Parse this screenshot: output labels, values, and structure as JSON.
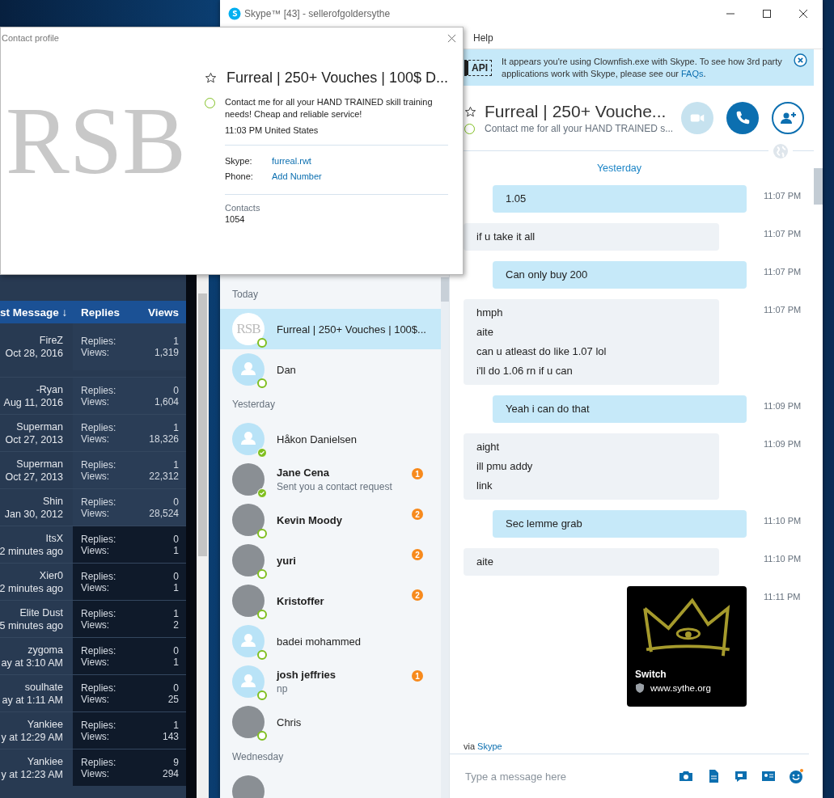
{
  "forum": {
    "columns": [
      "st Message ↓",
      "Replies",
      "Views"
    ],
    "rows": [
      {
        "poster": "FireZ",
        "date": "Oct 28, 2016",
        "replies_label": "Replies:",
        "replies": "1",
        "views_label": "Views:",
        "views": "1,319",
        "shaded": false
      },
      {
        "poster": "-Ryan",
        "date": "Aug 11, 2016",
        "replies_label": "Replies:",
        "replies": "0",
        "views_label": "Views:",
        "views": "1,604",
        "shaded": false
      },
      {
        "poster": "Superman",
        "date": "Oct 27, 2013",
        "replies_label": "Replies:",
        "replies": "1",
        "views_label": "Views:",
        "views": "18,326",
        "shaded": false
      },
      {
        "poster": "Superman",
        "date": "Oct 27, 2013",
        "replies_label": "Replies:",
        "replies": "1",
        "views_label": "Views:",
        "views": "22,312",
        "shaded": false
      },
      {
        "poster": "Shin",
        "date": "Jan 30, 2012",
        "replies_label": "Replies:",
        "replies": "0",
        "views_label": "Views:",
        "views": "28,524",
        "shaded": false
      },
      {
        "poster": "ItsX",
        "date": "2 minutes ago",
        "replies_label": "Replies:",
        "replies": "0",
        "views_label": "Views:",
        "views": "1",
        "shaded": true
      },
      {
        "poster": "Xier0",
        "date": "2 minutes ago",
        "replies_label": "Replies:",
        "replies": "0",
        "views_label": "Views:",
        "views": "1",
        "shaded": true
      },
      {
        "poster": "Elite Dust",
        "date": "5 minutes ago",
        "replies_label": "Replies:",
        "replies": "1",
        "views_label": "Views:",
        "views": "2",
        "shaded": true
      },
      {
        "poster": "zygoma",
        "date": "ay at 3:10 AM",
        "replies_label": "Replies:",
        "replies": "0",
        "views_label": "Views:",
        "views": "1",
        "shaded": true
      },
      {
        "poster": "soulhate",
        "date": "ay at 1:11 AM",
        "replies_label": "Replies:",
        "replies": "0",
        "views_label": "Views:",
        "views": "25",
        "shaded": true
      },
      {
        "poster": "Yankiee",
        "date": "y at 12:29 AM",
        "replies_label": "Replies:",
        "replies": "1",
        "views_label": "Views:",
        "views": "143",
        "shaded": true
      },
      {
        "poster": "Yankiee",
        "date": "y at 12:23 AM",
        "replies_label": "Replies:",
        "replies": "9",
        "views_label": "Views:",
        "views": "294",
        "shaded": true
      }
    ]
  },
  "skype": {
    "title": "Skype™ [43] - sellerofgoldersythe",
    "menu": [
      "Help"
    ],
    "contact_groups": [
      {
        "label": "Today",
        "contacts": [
          {
            "name": "Furreal | 250+ Vouches | 100$...",
            "kind": "logo",
            "avatar_text": "RSB",
            "available": false,
            "selected": true
          },
          {
            "name": "Dan",
            "kind": "default",
            "available": false,
            "selected": false
          }
        ]
      },
      {
        "label": "Yesterday",
        "contacts": [
          {
            "name": "Håkon Danielsen",
            "kind": "default",
            "available": true,
            "selected": false
          },
          {
            "name": "Jane Cena",
            "subtitle": "Sent you a contact request",
            "badge": "1",
            "kind": "photo",
            "available": true,
            "selected": false
          },
          {
            "name": "Kevin Moody",
            "badge": "2",
            "kind": "photo",
            "available": false,
            "selected": false
          },
          {
            "name": "yuri",
            "badge": "2",
            "kind": "photo",
            "available": false,
            "selected": false
          },
          {
            "name": "Kristoffer",
            "badge": "2",
            "kind": "photo",
            "available": false,
            "selected": false
          },
          {
            "name": "badei mohammed",
            "kind": "default",
            "available": false,
            "selected": false
          },
          {
            "name": "josh jeffries",
            "subtitle": "np",
            "badge": "1",
            "kind": "default",
            "available": false,
            "selected": false
          },
          {
            "name": "Chris",
            "kind": "photo",
            "available": false,
            "selected": false
          }
        ]
      },
      {
        "label": "Wednesday",
        "contacts": [
          {
            "kind": "photo",
            "selected": false
          }
        ]
      }
    ],
    "banner": {
      "icon_text": "API",
      "text": "It appears you're using Clownfish.exe with Skype.  To see how 3rd party applications work with Skype, please see our ",
      "link": "FAQs",
      "after": "."
    },
    "chat_header": {
      "name": "Furreal | 250+ Vouche...",
      "mood": "Contact me for all your HAND TRAINED s...",
      "favorite": false,
      "online": true,
      "buttons": [
        {
          "kind": "video",
          "disabled": true
        },
        {
          "kind": "call",
          "disabled": false
        },
        {
          "kind": "add_contact",
          "disabled": false
        }
      ]
    },
    "day_label": "Yesterday",
    "messages": [
      {
        "kind": "text",
        "outgoing": true,
        "lines": [
          "1.05"
        ],
        "time": "11:07 PM"
      },
      {
        "kind": "text",
        "outgoing": false,
        "lines": [
          "if u take it all"
        ],
        "time": "11:07 PM"
      },
      {
        "kind": "text",
        "outgoing": true,
        "lines": [
          "Can only buy 200"
        ],
        "time": "11:07 PM"
      },
      {
        "kind": "text",
        "outgoing": false,
        "lines": [
          "hmph",
          "aite",
          "can u atleast do like 1.07 lol",
          "i'll do 1.06 rn if u can"
        ],
        "time": "11:07 PM"
      },
      {
        "kind": "text",
        "outgoing": true,
        "lines": [
          "Yeah i can do that"
        ],
        "time": "11:09 PM"
      },
      {
        "kind": "text",
        "outgoing": false,
        "lines": [
          "aight",
          "ill pmu  addy",
          "link"
        ],
        "time": "11:09 PM"
      },
      {
        "kind": "text",
        "outgoing": true,
        "lines": [
          "Sec lemme grab"
        ],
        "time": "11:10 PM"
      },
      {
        "kind": "text",
        "outgoing": false,
        "lines": [
          "aite"
        ],
        "time": "11:10 PM"
      },
      {
        "kind": "link_card",
        "outgoing": true,
        "title": "Switch",
        "url": "www.sythe.org",
        "time": "11:11 PM"
      }
    ],
    "via": {
      "text": "via",
      "link": "Skype"
    },
    "input": {
      "placeholder": "Type a message here"
    }
  },
  "profile": {
    "title": "Contact profile",
    "logo_text": "RSB",
    "name": "Furreal | 250+ Vouches | 100$ D...",
    "favorite": false,
    "online": true,
    "mood": "Contact me for all your HAND TRAINED skill training needs! Cheap and reliable service!",
    "local_time": "11:03 PM United States",
    "fields": [
      {
        "label": "Skype:",
        "value": "furreal.rwt"
      },
      {
        "label": "Phone:",
        "value": "Add Number"
      }
    ],
    "contacts_label": "Contacts",
    "contacts_count": "1054"
  }
}
